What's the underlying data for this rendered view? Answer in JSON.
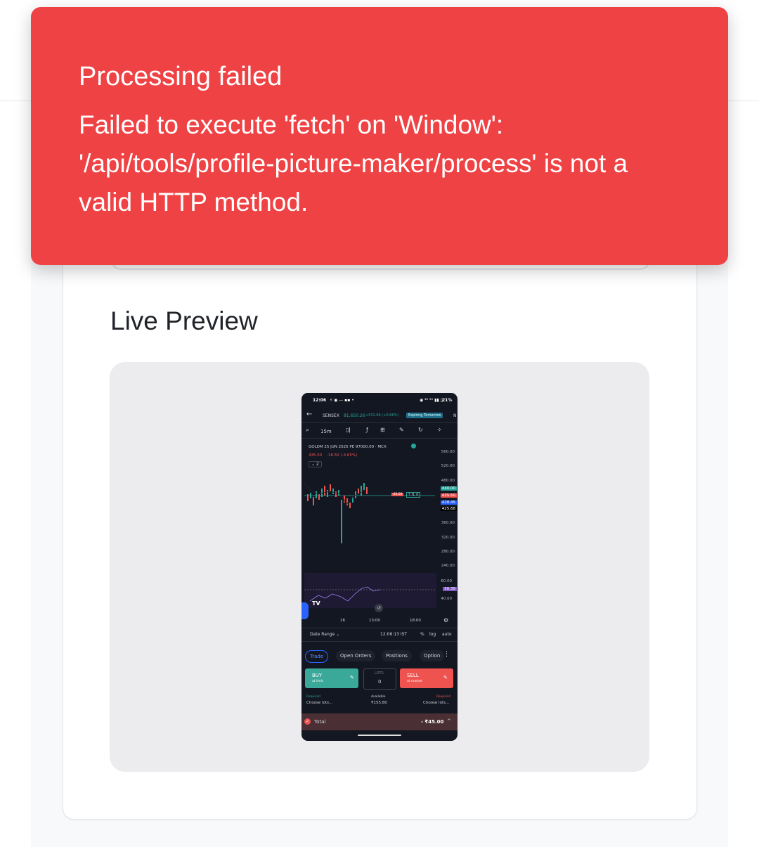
{
  "toast": {
    "title": "Processing failed",
    "message": "Failed to execute 'fetch' on 'Window': '/api/tools/profile-picture-maker/process' is not a valid HTTP method.",
    "color": "#ef4244"
  },
  "preview": {
    "heading": "Live Preview"
  },
  "phone": {
    "status": {
      "time": "12:06",
      "battery": "21%"
    },
    "topbar": {
      "symbol": "SENSEX",
      "price": "81,650.26",
      "change": "+531.66 (+0.66%)",
      "expiring": "Expiring Tomorrow",
      "overflow": "N"
    },
    "toolbar": {
      "interval": "15m"
    },
    "chart": {
      "instrument": "GOLDM 25 JUN 2025 PE 97000.00 · MCX",
      "last_price": "435.50",
      "change": "-16.50 (-3.65%)",
      "indicator_count": "2",
      "axis": [
        "560.00",
        "520.00",
        "480.00",
        "360.00",
        "320.00",
        "280.00",
        "240.00"
      ],
      "tags": {
        "green": "440.00",
        "red": "435.50",
        "blue": "428.45",
        "dark": "425.68"
      },
      "order_line_label": "-45.00",
      "rsi_axis": [
        "60.00",
        "40.00"
      ],
      "rsi_tag": "50.39",
      "time_labels": [
        "16",
        "13:00",
        "18:00"
      ],
      "date_range": "Date Range",
      "timestamp": "12:06:13 IST",
      "pct": "%",
      "log": "log",
      "auto": "auto"
    },
    "tabs": [
      "Trade",
      "Open Orders",
      "Positions",
      "Option"
    ],
    "buy": {
      "label": "BUY",
      "sub": "at limit"
    },
    "lots": {
      "label": "LOTS",
      "value": "0"
    },
    "sell": {
      "label": "SELL",
      "sub": "at market"
    },
    "margin": {
      "required_label": "Required",
      "required_value": "Choose lots...",
      "available_label": "Available",
      "available_value": "₹155.80",
      "required2_label": "Required",
      "required2_value": "Choose lots..."
    },
    "total": {
      "label": "Total",
      "value": "- ₹45.00"
    }
  }
}
